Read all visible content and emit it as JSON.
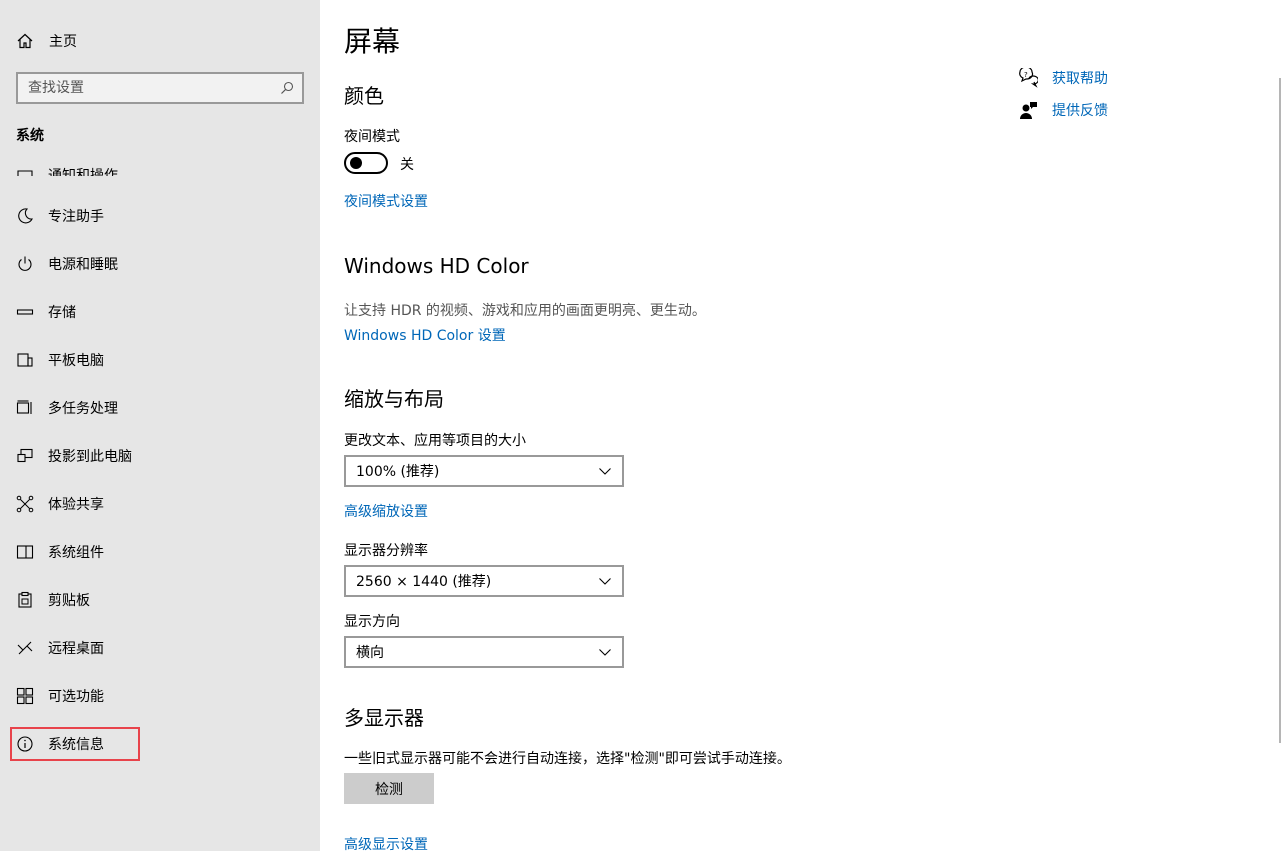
{
  "sidebar": {
    "home_label": "主页",
    "search_placeholder": "查找设置",
    "section_label": "系统",
    "items": [
      {
        "label": "通知和操作",
        "icon": "notification-icon"
      },
      {
        "label": "专注助手",
        "icon": "moon-icon"
      },
      {
        "label": "电源和睡眠",
        "icon": "power-icon"
      },
      {
        "label": "存储",
        "icon": "storage-icon"
      },
      {
        "label": "平板电脑",
        "icon": "tablet-icon"
      },
      {
        "label": "多任务处理",
        "icon": "multitask-icon"
      },
      {
        "label": "投影到此电脑",
        "icon": "project-icon"
      },
      {
        "label": "体验共享",
        "icon": "share-icon"
      },
      {
        "label": "系统组件",
        "icon": "components-icon"
      },
      {
        "label": "剪贴板",
        "icon": "clipboard-icon"
      },
      {
        "label": "远程桌面",
        "icon": "remote-desktop-icon"
      },
      {
        "label": "可选功能",
        "icon": "features-icon"
      },
      {
        "label": "系统信息",
        "icon": "info-icon"
      }
    ]
  },
  "main": {
    "title": "屏幕",
    "color": {
      "heading": "颜色",
      "night_mode_label": "夜间模式",
      "night_mode_state": "关",
      "night_mode_link": "夜间模式设置"
    },
    "hdr": {
      "heading": "Windows HD Color",
      "desc": "让支持 HDR 的视频、游戏和应用的画面更明亮、更生动。",
      "link": "Windows HD Color 设置"
    },
    "scale": {
      "heading": "缩放与布局",
      "text_size_label": "更改文本、应用等项目的大小",
      "text_size_value": "100% (推荐)",
      "advanced_link": "高级缩放设置",
      "resolution_label": "显示器分辨率",
      "resolution_value": "2560 × 1440 (推荐)",
      "orientation_label": "显示方向",
      "orientation_value": "横向"
    },
    "multi": {
      "heading": "多显示器",
      "desc": "一些旧式显示器可能不会进行自动连接，选择\"检测\"即可尝试手动连接。",
      "detect_button": "检测",
      "advanced_link": "高级显示设置"
    }
  },
  "help": {
    "get_help": "获取帮助",
    "feedback": "提供反馈"
  },
  "colors": {
    "link": "#0067b8",
    "sidebar_bg": "#e6e6e6",
    "highlight": "#e8434b"
  }
}
